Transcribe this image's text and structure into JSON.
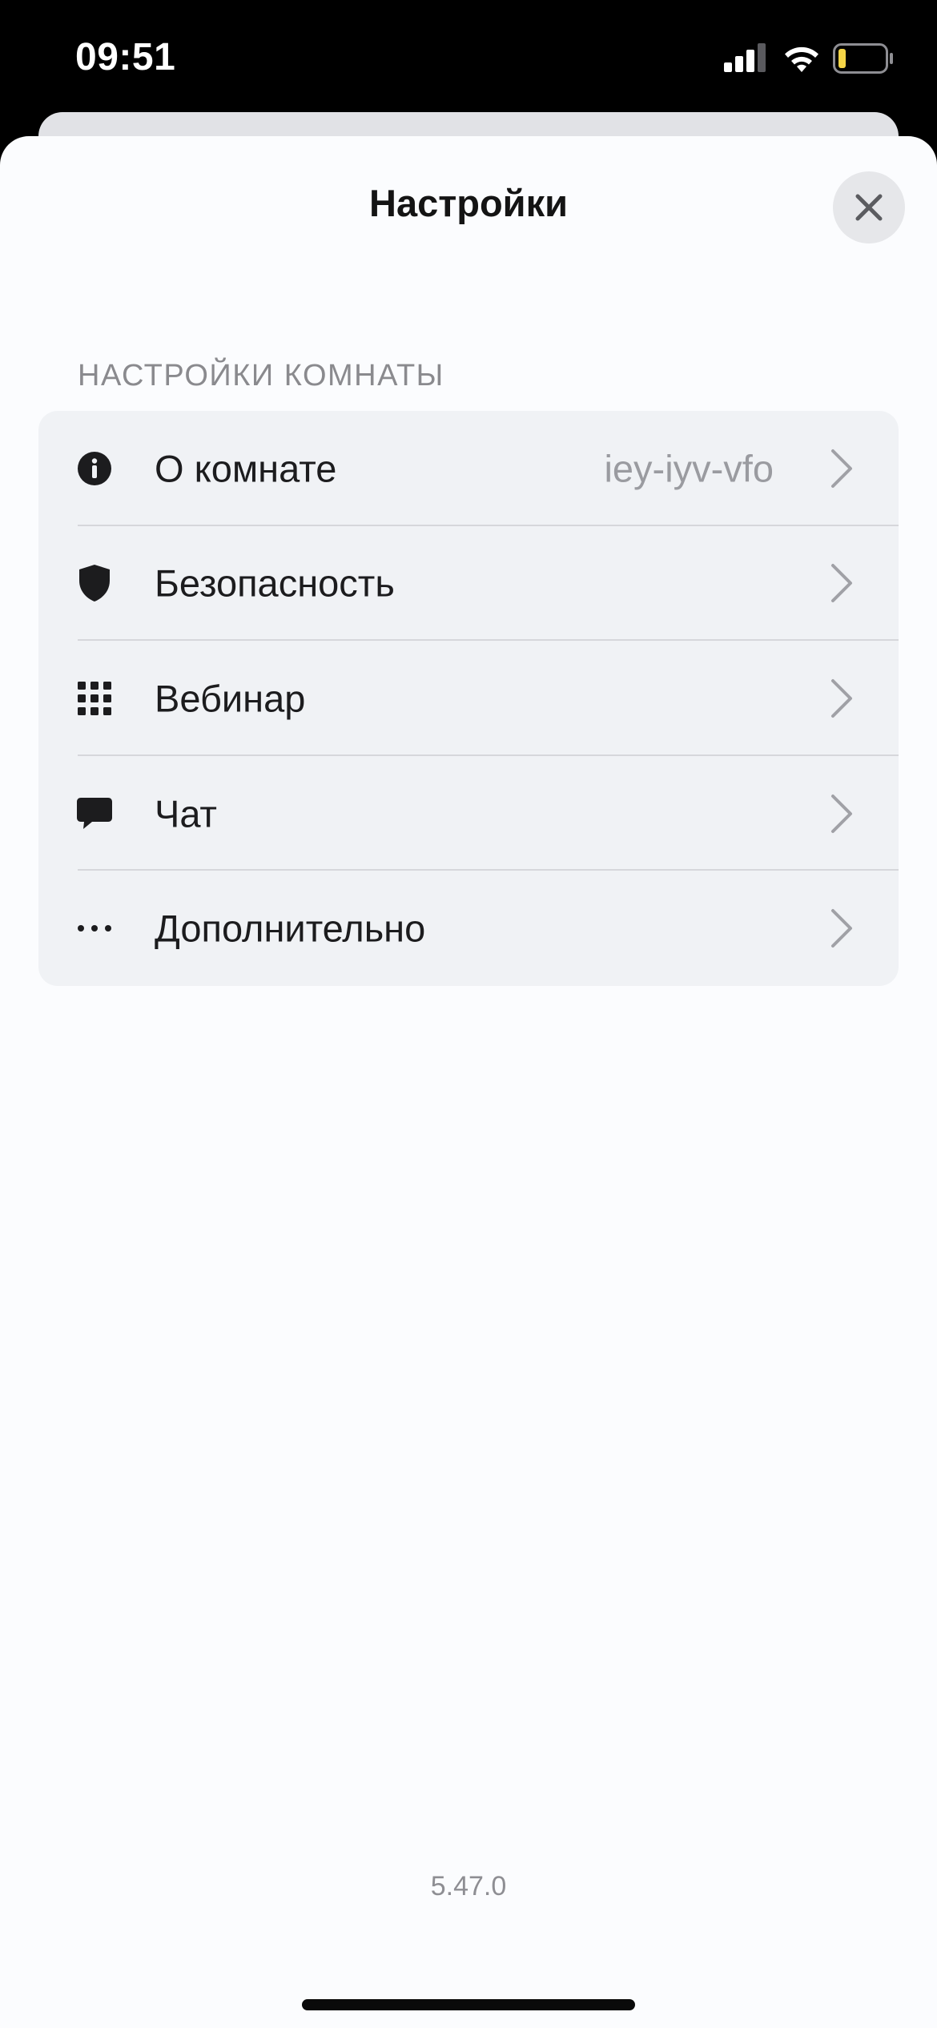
{
  "status_bar": {
    "time": "09:51"
  },
  "sheet": {
    "title": "Настройки",
    "close_icon": "close-icon"
  },
  "room_settings": {
    "section_header": "НАСТРОЙКИ КОМНАТЫ",
    "items": [
      {
        "label": "О комнате",
        "value": "iey-iyv-vfo",
        "icon": "info-icon"
      },
      {
        "label": "Безопасность",
        "value": "",
        "icon": "shield-icon"
      },
      {
        "label": "Вебинар",
        "value": "",
        "icon": "grid-icon"
      },
      {
        "label": "Чат",
        "value": "",
        "icon": "chat-bubble-icon"
      },
      {
        "label": "Дополнительно",
        "value": "",
        "icon": "more-dots-icon"
      }
    ]
  },
  "footer": {
    "version": "5.47.0"
  },
  "colors": {
    "sheet_background": "#fbfcfe",
    "group_background": "#f0f2f5",
    "secondary_text": "#8e8e93",
    "primary_text": "#1c1c1e",
    "battery_level_color": "#f5d547"
  }
}
